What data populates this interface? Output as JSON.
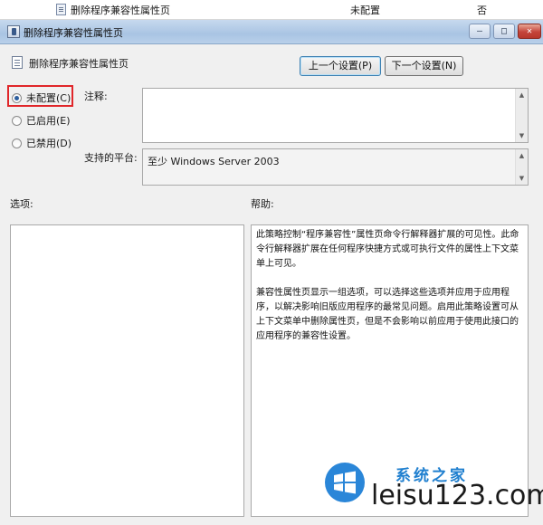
{
  "background_list": {
    "row_name": "删除程序兼容性属性页",
    "row_state": "未配置",
    "row_comment": "否"
  },
  "window": {
    "title": "删除程序兼容性属性页",
    "minimize_label": "—",
    "maximize_label": "□",
    "close_label": "✕"
  },
  "header": {
    "policy_title": "删除程序兼容性属性页",
    "prev_button": "上一个设置(P)",
    "next_button": "下一个设置(N)"
  },
  "state_options": {
    "selected": "not_configured",
    "items": [
      {
        "key": "not_configured",
        "label": "未配置(C)"
      },
      {
        "key": "enabled",
        "label": "已启用(E)"
      },
      {
        "key": "disabled",
        "label": "已禁用(D)"
      }
    ]
  },
  "comment": {
    "label": "注释:",
    "value": ""
  },
  "supported_on": {
    "label": "支持的平台:",
    "value": "至少 Windows Server 2003"
  },
  "options": {
    "label": "选项:"
  },
  "help": {
    "label": "帮助:",
    "paragraphs": [
      "此策略控制“程序兼容性”属性页命令行解释器扩展的可见性。此命令行解释器扩展在任何程序快捷方式或可执行文件的属性上下文菜单上可见。",
      "兼容性属性页显示一组选项，可以选择这些选项并应用于应用程序，以解决影响旧版应用程序的最常见问题。启用此策略设置可从上下文菜单中删除属性页，但是不会影响以前应用于使用此接口的应用程序的兼容性设置。"
    ]
  },
  "watermark": {
    "top_text": "系统之家",
    "domain_text": "leisu123.com"
  },
  "colors": {
    "highlight_border": "#e0262a",
    "titlebar": "#b9d0ea",
    "radio_dot": "#2c5e9e"
  }
}
